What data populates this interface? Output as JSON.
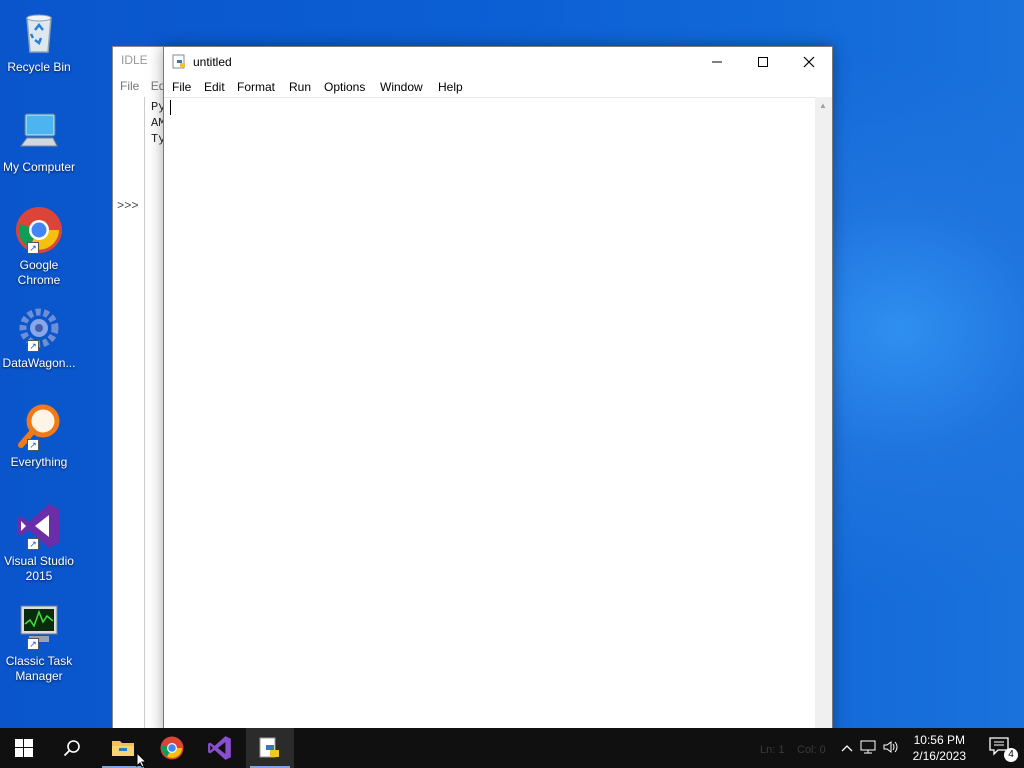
{
  "desktop": {
    "icons": [
      {
        "label": "Recycle Bin"
      },
      {
        "label": "My Computer"
      },
      {
        "label": "Google Chrome"
      },
      {
        "label": "DataWagon..."
      },
      {
        "label": "Everything"
      },
      {
        "label": "Visual Studio 2015"
      },
      {
        "label": "Classic Task Manager"
      }
    ]
  },
  "shell_window": {
    "title": "IDLE",
    "menu": [
      "File",
      "Ed"
    ],
    "prompt": ">>>",
    "lines": [
      "Py",
      "AM",
      "Ty"
    ]
  },
  "editor_window": {
    "title": "untitled",
    "menu": [
      "File",
      "Edit",
      "Format",
      "Run",
      "Options",
      "Window",
      "Help"
    ]
  },
  "taskbar": {
    "status_ghost": [
      "Ln: 1",
      "Col: 0"
    ],
    "clock_time": "10:56 PM",
    "clock_date": "2/16/2023",
    "notification_count": "4"
  }
}
